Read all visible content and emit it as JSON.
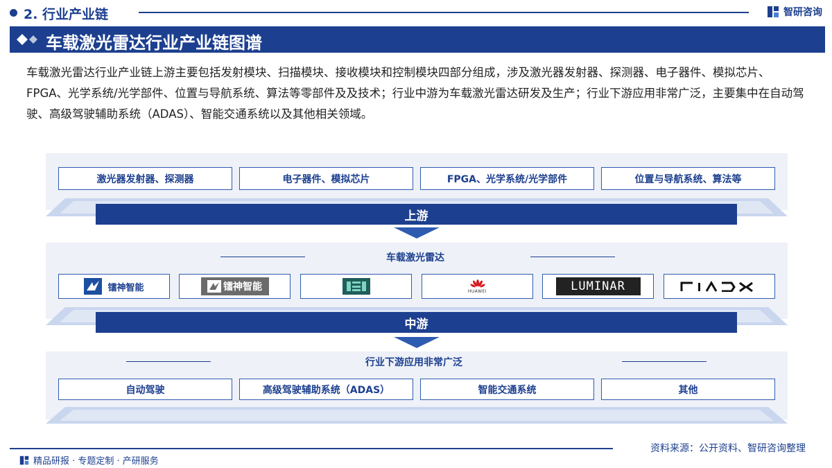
{
  "header": {
    "section_title": "2. 行业产业链",
    "brand_name": "智研咨询"
  },
  "title": "车载激光雷达行业产业链图谱",
  "intro": "车载激光雷达行业产业链上游主要包括发射模块、扫描模块、接收模块和控制模块四部分组成，涉及激光器发射器、探测器、电子器件、模拟芯片、FPGA、光学系统/光学部件、位置与导航系统、算法等零部件及及技术；行业中游为车载激光雷达研发及生产；行业下游应用非常广泛，主要集中在自动驾驶、高级驾驶辅助系统（ADAS）、智能交通系统以及其他相关领域。",
  "upstream": {
    "items": [
      "激光器发射器、探测器",
      "电子器件、模拟芯片",
      "FPGA、光学系统/光学部件",
      "位置与导航系统、算法等"
    ],
    "label": "上游"
  },
  "midstream": {
    "subtitle": "车载激光雷达",
    "logos": [
      {
        "name": "镭神智能",
        "style": "light"
      },
      {
        "name": "镭神智能",
        "style": "dark"
      },
      {
        "name": "",
        "style": "teal-mark"
      },
      {
        "name": "HUAWEI",
        "style": "huawei"
      },
      {
        "name": "LUMINAR",
        "style": "luminar"
      },
      {
        "name": "RIADX",
        "style": "riadx"
      }
    ],
    "label": "中游"
  },
  "downstream": {
    "subtitle": "行业下游应用非常广泛",
    "items": [
      "自动驾驶",
      "高级驾驶辅助系统（ADAS）",
      "智能交通系统",
      "其他"
    ]
  },
  "footer": {
    "source": "资料来源：公开资料、智研咨询整理",
    "tagline": "精品研报 · 专题定制 · 产研服务"
  },
  "colors": {
    "primary": "#1c3f8f",
    "panel": "#eef1f7",
    "accent": "#2d5bb0"
  }
}
